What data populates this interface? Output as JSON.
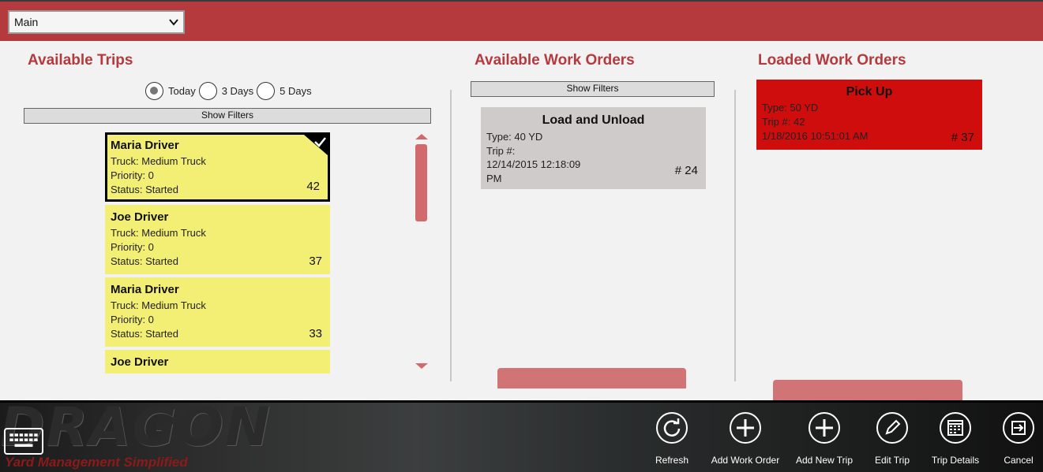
{
  "topbar": {
    "view_select": "Main"
  },
  "available_trips": {
    "title": "Available Trips",
    "ranges": [
      "Today",
      "3 Days",
      "5 Days"
    ],
    "selected_range": "Today",
    "filter_label": "Show Filters",
    "trips": [
      {
        "driver": "Maria Driver",
        "truck": "Truck: Medium Truck",
        "priority": "Priority: 0",
        "status": "Status: Started",
        "number": "42",
        "selected": true
      },
      {
        "driver": "Joe Driver",
        "truck": "Truck: Medium Truck",
        "priority": "Priority: 0",
        "status": "Status: Started",
        "number": "37"
      },
      {
        "driver": "Maria Driver",
        "truck": "Truck: Medium Truck",
        "priority": "Priority: 0",
        "status": "Status: Started",
        "number": "33"
      },
      {
        "driver": "Joe Driver",
        "truck": "",
        "priority": "",
        "status": "",
        "number": ""
      }
    ]
  },
  "available_work_orders": {
    "title": "Available Work Orders",
    "filter_label": "Show Filters",
    "orders": [
      {
        "title": "Load and Unload",
        "type": "Type: 40 YD",
        "trip": "Trip #:",
        "datetime": "12/14/2015 12:18:09 PM",
        "number": "# 24"
      }
    ]
  },
  "loaded_work_orders": {
    "title": "Loaded Work Orders",
    "orders": [
      {
        "title": "Pick Up",
        "type": "Type: 50 YD",
        "trip": "Trip #: 42",
        "datetime": "1/18/2016 10:51:01 AM",
        "number": "# 37"
      }
    ]
  },
  "appbar": {
    "brand": "DRAGON",
    "tagline": "Yard Management Simplified",
    "buttons": [
      {
        "label": "Refresh",
        "icon": "refresh-icon"
      },
      {
        "label": "Add Work Order",
        "icon": "plus-icon"
      },
      {
        "label": "Add New Trip",
        "icon": "plus-icon"
      },
      {
        "label": "Edit Trip",
        "icon": "pencil-icon"
      },
      {
        "label": "Trip Details",
        "icon": "calendar-icon"
      },
      {
        "label": "Cancel",
        "icon": "exit-icon"
      }
    ]
  },
  "colors": {
    "accent": "#b53a3d",
    "trip_card": "#f3ef74",
    "work_order_card": "#cfcbcb",
    "loaded_card": "#cf0d0d"
  }
}
